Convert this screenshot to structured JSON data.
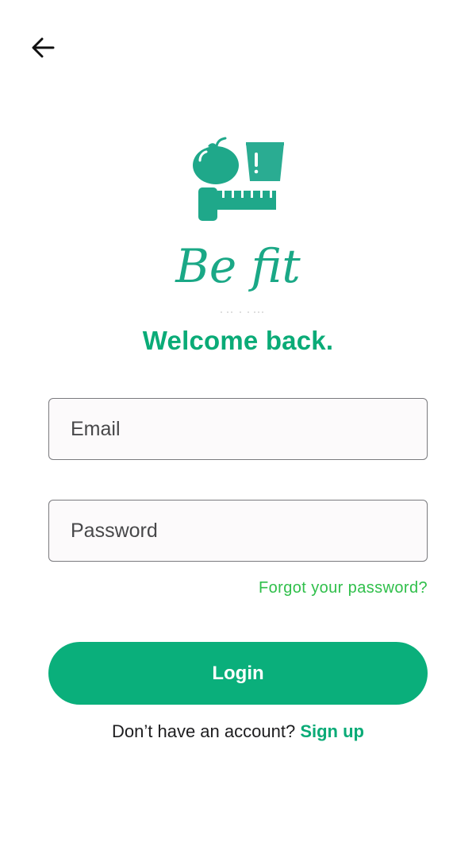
{
  "header": {
    "back_icon": "arrow-left-icon"
  },
  "logo": {
    "icons": [
      "apple-icon",
      "glass-icon",
      "tape-measure-icon"
    ],
    "wordmark": "Be fit",
    "color": "#1aa886"
  },
  "title": "Welcome back.",
  "form": {
    "email_placeholder": "Email",
    "password_placeholder": "Password",
    "forgot_label": "Forgot your password?",
    "login_label": "Login"
  },
  "signup": {
    "prompt": "Don’t have an account?",
    "link_label": "Sign up"
  },
  "colors": {
    "accent": "#0aab77",
    "button": "#0aaf7b",
    "forgot_link": "#2fbf4a",
    "field_border": "#7a7a7e",
    "field_bg": "#fcfafb"
  }
}
